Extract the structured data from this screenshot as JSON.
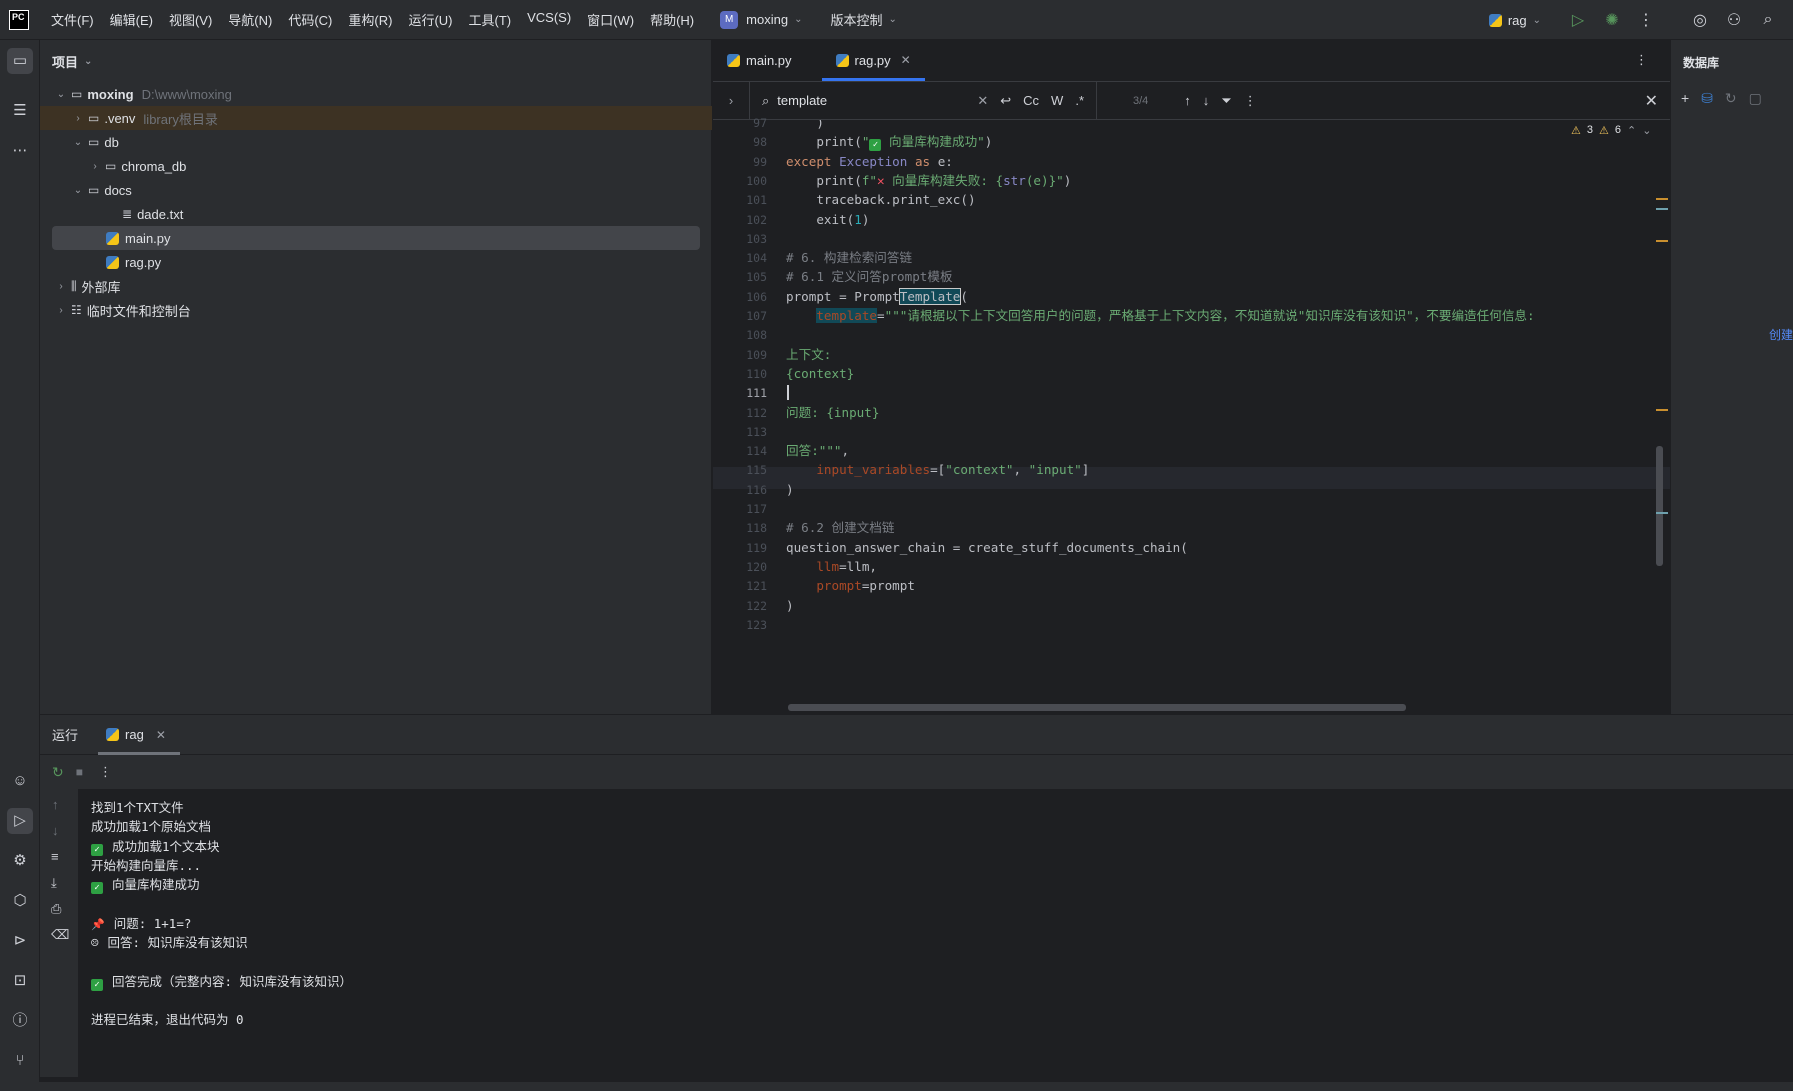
{
  "menu": [
    "文件(F)",
    "编辑(E)",
    "视图(V)",
    "导航(N)",
    "代码(C)",
    "重构(R)",
    "运行(U)",
    "工具(T)",
    "VCS(S)",
    "窗口(W)",
    "帮助(H)"
  ],
  "project_switcher": {
    "badge": "M",
    "name": "moxing"
  },
  "vcs_label": "版本控制",
  "run_config": "rag",
  "project_panel": {
    "title": "项目",
    "tree": [
      {
        "label": "moxing",
        "hint": "D:\\www\\moxing",
        "indent": 0,
        "arrow": "⌄",
        "icon": "folder",
        "bold": true
      },
      {
        "label": ".venv",
        "hint": "library根目录",
        "indent": 1,
        "arrow": "›",
        "icon": "folder",
        "excluded": true
      },
      {
        "label": "db",
        "hint": "",
        "indent": 1,
        "arrow": "⌄",
        "icon": "folder"
      },
      {
        "label": "chroma_db",
        "hint": "",
        "indent": 2,
        "arrow": "›",
        "icon": "folder"
      },
      {
        "label": "docs",
        "hint": "",
        "indent": 1,
        "arrow": "⌄",
        "icon": "folder"
      },
      {
        "label": "dade.txt",
        "hint": "",
        "indent": 3,
        "arrow": "",
        "icon": "text"
      },
      {
        "label": "main.py",
        "hint": "",
        "indent": 2,
        "arrow": "",
        "icon": "python",
        "selected": true
      },
      {
        "label": "rag.py",
        "hint": "",
        "indent": 2,
        "arrow": "",
        "icon": "python"
      },
      {
        "label": "外部库",
        "hint": "",
        "indent": 0,
        "arrow": "›",
        "icon": "library"
      },
      {
        "label": "临时文件和控制台",
        "hint": "",
        "indent": 0,
        "arrow": "›",
        "icon": "scratch"
      }
    ]
  },
  "editor_tabs": [
    {
      "label": "main.py",
      "active": false
    },
    {
      "label": "rag.py",
      "active": true
    }
  ],
  "search": {
    "value": "template",
    "count": "3/4",
    "options": [
      "Cc",
      "W",
      ".*"
    ]
  },
  "inspections": {
    "warnings": "3",
    "weak": "6"
  },
  "code_lines": [
    {
      "n": "97",
      "html": "    )"
    },
    {
      "n": "98",
      "html": "    print(\"<span class='chk'>✓</span> 向量库构建成功\")",
      "strs": true
    },
    {
      "n": "99",
      "html": "<span class='kw'>except</span> <span class='bi'>Exception</span> <span class='kw'>as</span> e:"
    },
    {
      "n": "100",
      "html": "    print(f\"<span class='crs'>✕</span> 向量库构建失败: {<span class='bi'>str</span>(e)}\")"
    },
    {
      "n": "101",
      "html": "    traceback.print_exc()"
    },
    {
      "n": "102",
      "html": "    exit(<span class='num'>1</span>)"
    },
    {
      "n": "103",
      "html": ""
    },
    {
      "n": "104",
      "html": "<span class='cm'># 6. 构建检索问答链</span>"
    },
    {
      "n": "105",
      "html": "<span class='cm'># 6.1 定义问答prompt模板</span>"
    },
    {
      "n": "106",
      "html": "prompt = Prompt<span class='hl'>Template</span>("
    },
    {
      "n": "107",
      "html": "    <span class='par hl2'>template</span>=<span class='str'>\"\"\"请根据以下上下文回答用户的问题，严格基于上下文内容，不知道就说\"知识库没有该知识\"，不要编造任何信息:</span>"
    },
    {
      "n": "108",
      "html": ""
    },
    {
      "n": "109",
      "html": "<span class='str'>上下文:</span>"
    },
    {
      "n": "110",
      "html": "<span class='str'>{context}</span>"
    },
    {
      "n": "111",
      "html": "",
      "current": true
    },
    {
      "n": "112",
      "html": "<span class='str'>问题: {input}</span>"
    },
    {
      "n": "113",
      "html": ""
    },
    {
      "n": "114",
      "html": "<span class='str'>回答:\"\"\"</span>,"
    },
    {
      "n": "115",
      "html": "    <span class='par'>input_variables</span>=[<span class='str'>\"context\"</span>, <span class='str'>\"input\"</span>]"
    },
    {
      "n": "116",
      "html": ")"
    },
    {
      "n": "117",
      "html": ""
    },
    {
      "n": "118",
      "html": "<span class='cm'># 6.2 创建文档链</span>"
    },
    {
      "n": "119",
      "html": "question_answer_chain = create_stuff_documents_chain("
    },
    {
      "n": "120",
      "html": "    <span class='par'>llm</span>=llm,"
    },
    {
      "n": "121",
      "html": "    <span class='par'>prompt</span>=prompt"
    },
    {
      "n": "122",
      "html": ")"
    },
    {
      "n": "123",
      "html": ""
    }
  ],
  "right_panel": {
    "title": "数据库",
    "side_link": "创建"
  },
  "run_panel": {
    "title": "运行",
    "tab": "rag",
    "output": [
      {
        "text": "找到1个TXT文件",
        "icon": ""
      },
      {
        "text": "成功加载1个原始文档",
        "icon": ""
      },
      {
        "text": "成功加载1个文本块",
        "icon": "check"
      },
      {
        "text": "开始构建向量库...",
        "icon": ""
      },
      {
        "text": "向量库构建成功",
        "icon": "check"
      },
      {
        "text": "",
        "icon": ""
      },
      {
        "text": "问题: 1+1=?",
        "icon": "pin"
      },
      {
        "text": "回答: 知识库没有该知识",
        "icon": "robot"
      },
      {
        "text": "",
        "icon": ""
      },
      {
        "text": "回答完成（完整内容: 知识库没有该知识）",
        "icon": "check"
      },
      {
        "text": "",
        "icon": ""
      },
      {
        "text": "进程已结束，退出代码为 0",
        "icon": ""
      }
    ]
  }
}
